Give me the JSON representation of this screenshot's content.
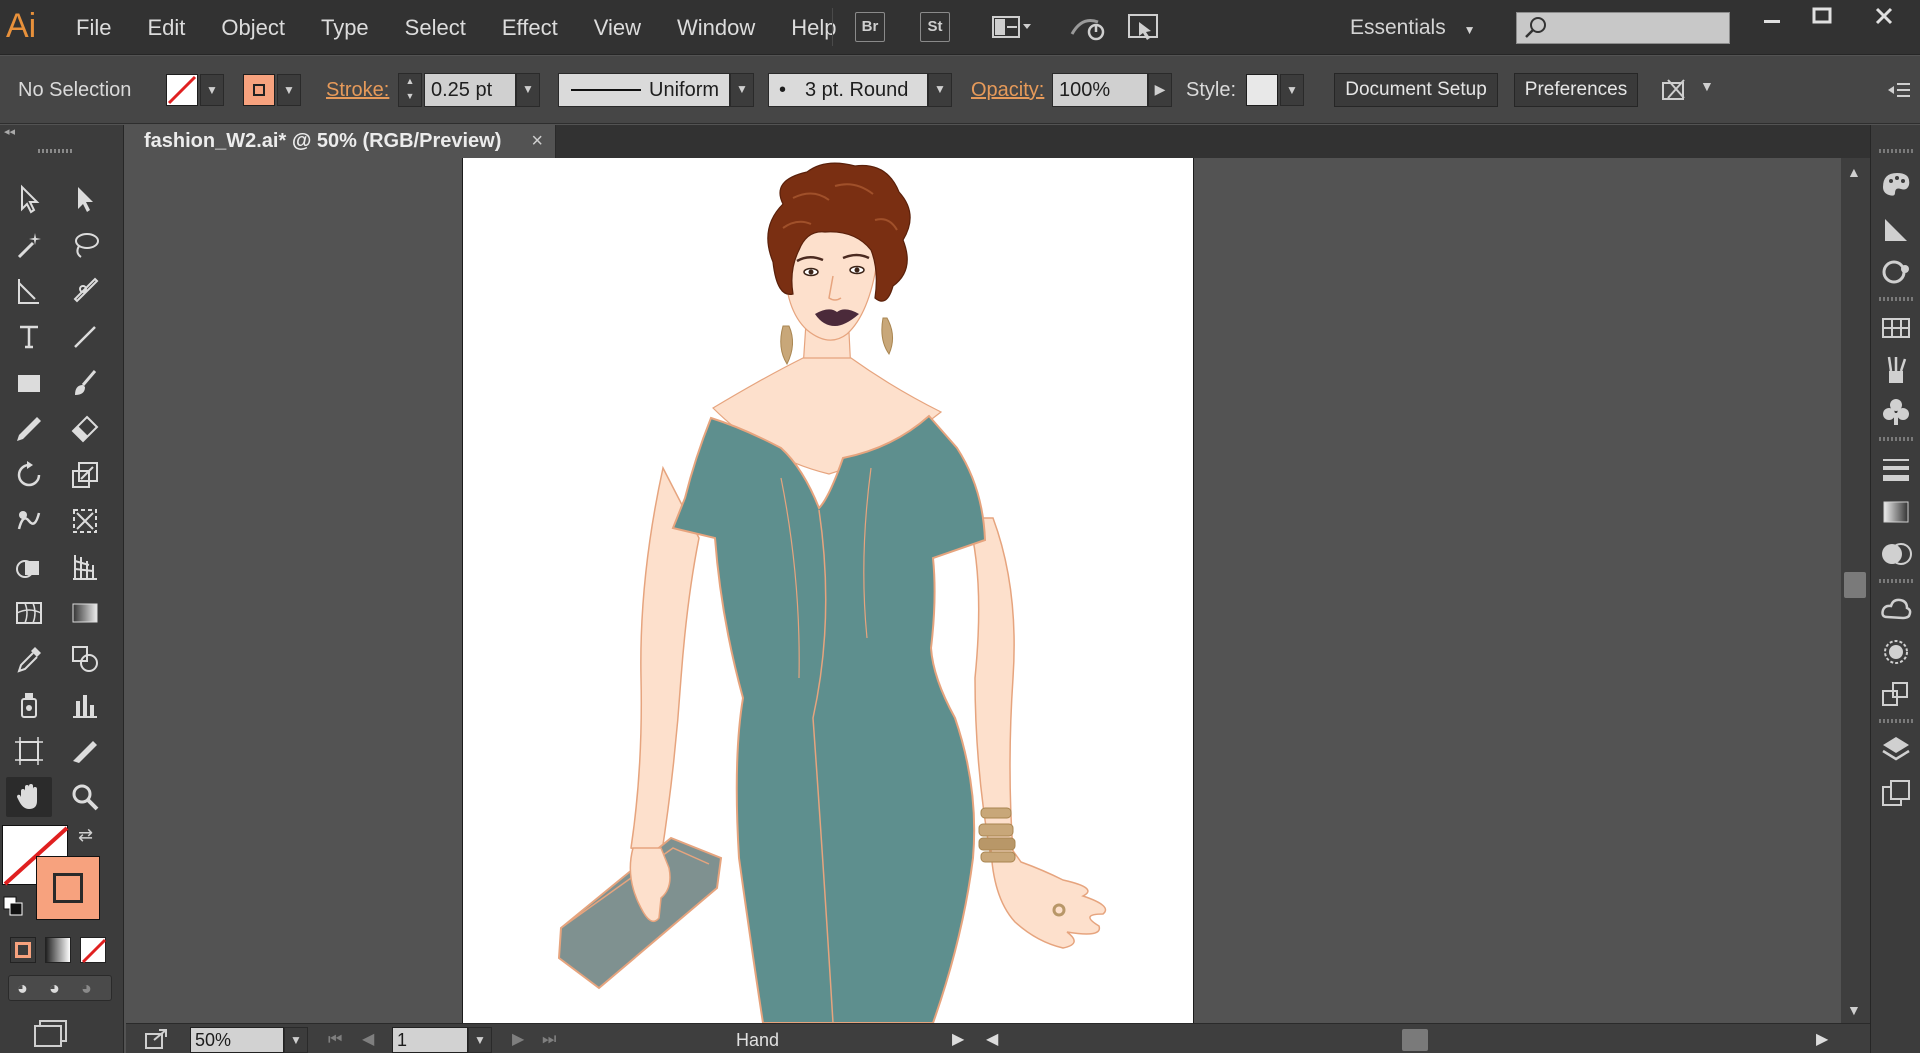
{
  "app": {
    "logo": "Ai",
    "workspace": "Essentials"
  },
  "menu": [
    "File",
    "Edit",
    "Object",
    "Type",
    "Select",
    "Effect",
    "View",
    "Window",
    "Help"
  ],
  "menubar_icons": {
    "bridge": "Br",
    "stock": "St"
  },
  "control": {
    "selection_label": "No Selection",
    "stroke_label": "Stroke:",
    "stroke_weight": "0.25 pt",
    "profile": "Uniform",
    "brush": "3 pt. Round",
    "opacity_label": "Opacity:",
    "opacity_value": "100%",
    "style_label": "Style:",
    "document_setup": "Document Setup",
    "preferences": "Preferences"
  },
  "document": {
    "tab_title": "fashion_W2.ai* @ 50% (RGB/Preview)",
    "close_glyph": "×"
  },
  "status": {
    "zoom": "50%",
    "artboard_number": "1",
    "tool_name": "Hand"
  },
  "colors": {
    "accent": "#e8913b",
    "stroke_swatch": "#f7a27e",
    "dress": "#5e8f8e",
    "skin": "#fde0cc",
    "hair": "#7a2f12",
    "clutch": "#7f9190",
    "jewelry": "#c8a779",
    "lips": "#4b2a3a"
  },
  "icons": {
    "search": "search-icon",
    "hand": "hand-icon",
    "selection": "selection-tool-icon"
  }
}
